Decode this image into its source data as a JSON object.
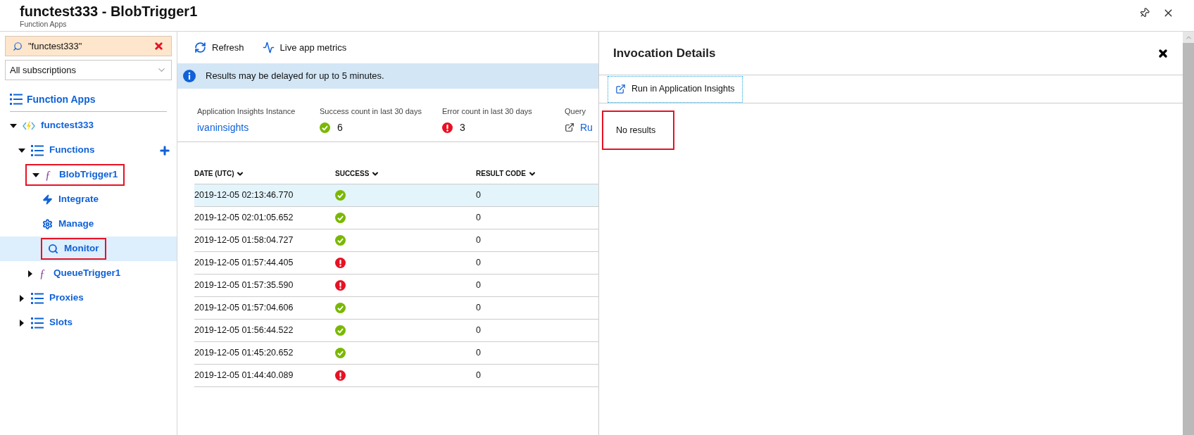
{
  "header": {
    "title": "functest333 - BlobTrigger1",
    "subtitle": "Function Apps"
  },
  "sidebar": {
    "search": {
      "value": "\"functest333\""
    },
    "subscription": {
      "value": "All subscriptions"
    },
    "root": {
      "label": "Function Apps"
    },
    "tree": [
      {
        "label": "functest333",
        "kind": "app",
        "expanded": true,
        "selected": false,
        "highlighted": false,
        "children": [
          {
            "label": "Functions",
            "kind": "list",
            "expanded": true,
            "selected": false,
            "highlighted": false,
            "addable": true,
            "children": [
              {
                "label": "BlobTrigger1",
                "kind": "function",
                "icon": "ƒ",
                "expanded": true,
                "selected": false,
                "highlighted": true,
                "children": [
                  {
                    "label": "Integrate",
                    "kind": "integrate",
                    "selected": false,
                    "highlighted": false
                  },
                  {
                    "label": "Manage",
                    "kind": "manage",
                    "selected": false,
                    "highlighted": false
                  },
                  {
                    "label": "Monitor",
                    "kind": "monitor",
                    "selected": true,
                    "highlighted": true
                  }
                ]
              },
              {
                "label": "QueueTrigger1",
                "kind": "function",
                "icon": "ƒ",
                "expanded": false,
                "selected": false,
                "highlighted": false
              }
            ]
          },
          {
            "label": "Proxies",
            "kind": "list",
            "expanded": false,
            "selected": false,
            "highlighted": false
          },
          {
            "label": "Slots",
            "kind": "list",
            "expanded": false,
            "selected": false,
            "highlighted": false
          }
        ]
      }
    ]
  },
  "toolbar": [
    {
      "label": "Refresh",
      "kind": "refresh"
    },
    {
      "label": "Live app metrics",
      "kind": "metrics"
    }
  ],
  "banner": {
    "text": "Results may be delayed for up to 5 minutes."
  },
  "stats": [
    {
      "label": "Application Insights Instance",
      "value": "ivaninsights",
      "kind": "link"
    },
    {
      "label": "Success count in last 30 days",
      "value": "6",
      "kind": "success"
    },
    {
      "label": "Error count in last 30 days",
      "value": "3",
      "kind": "error"
    },
    {
      "label": "Query",
      "value": "Ru",
      "kind": "external"
    }
  ],
  "table": {
    "columns": [
      "DATE (UTC)",
      "SUCCESS",
      "RESULT CODE"
    ],
    "rows": [
      {
        "date": "2019-12-05 02:13:46.770",
        "success": true,
        "result_code": "0",
        "selected": true
      },
      {
        "date": "2019-12-05 02:01:05.652",
        "success": true,
        "result_code": "0",
        "selected": false
      },
      {
        "date": "2019-12-05 01:58:04.727",
        "success": true,
        "result_code": "0",
        "selected": false
      },
      {
        "date": "2019-12-05 01:57:44.405",
        "success": false,
        "result_code": "0",
        "selected": false
      },
      {
        "date": "2019-12-05 01:57:35.590",
        "success": false,
        "result_code": "0",
        "selected": false
      },
      {
        "date": "2019-12-05 01:57:04.606",
        "success": true,
        "result_code": "0",
        "selected": false
      },
      {
        "date": "2019-12-05 01:56:44.522",
        "success": true,
        "result_code": "0",
        "selected": false
      },
      {
        "date": "2019-12-05 01:45:20.652",
        "success": true,
        "result_code": "0",
        "selected": false
      },
      {
        "date": "2019-12-05 01:44:40.089",
        "success": false,
        "result_code": "0",
        "selected": false
      }
    ]
  },
  "details": {
    "title": "Invocation Details",
    "button": "Run in Application Insights",
    "message": "No results",
    "message_highlighted": true
  }
}
